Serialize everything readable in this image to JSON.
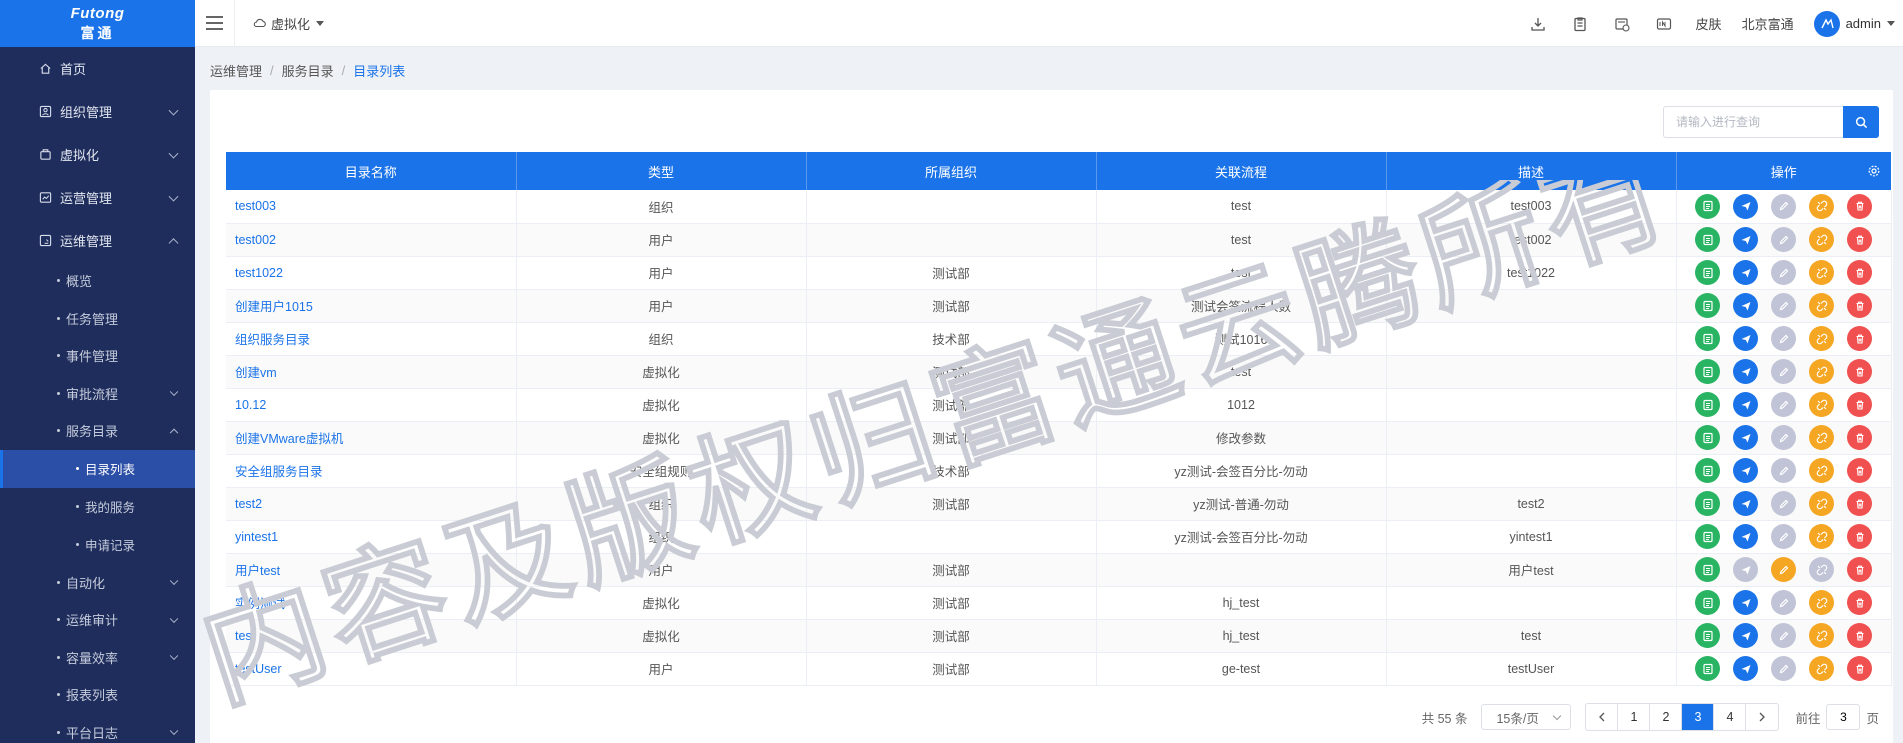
{
  "brand": {
    "name_en": "Futong",
    "name_cn": "富通",
    "color": "#1a73e8"
  },
  "sidebar": {
    "items": [
      {
        "label": "首页",
        "icon": "home-icon"
      },
      {
        "label": "组织管理",
        "icon": "org-icon"
      },
      {
        "label": "虚拟化",
        "icon": "virtualization-icon"
      },
      {
        "label": "运营管理",
        "icon": "operation-icon"
      },
      {
        "label": "运维管理",
        "icon": "maintenance-icon"
      }
    ],
    "sub_items": [
      {
        "label": "概览"
      },
      {
        "label": "任务管理"
      },
      {
        "label": "事件管理"
      },
      {
        "label": "审批流程"
      },
      {
        "label": "服务目录"
      }
    ],
    "catalog_children": [
      {
        "label": "目录列表"
      },
      {
        "label": "我的服务"
      },
      {
        "label": "申请记录"
      }
    ],
    "sub_items_after": [
      {
        "label": "自动化"
      },
      {
        "label": "运维审计"
      },
      {
        "label": "容量效率"
      },
      {
        "label": "报表列表"
      },
      {
        "label": "平台日志"
      }
    ]
  },
  "header": {
    "module": "虚拟化",
    "skin": "皮肤",
    "company": "北京富通",
    "user": "admin"
  },
  "breadcrumb": [
    "运维管理",
    "服务目录",
    "目录列表"
  ],
  "search": {
    "placeholder": "请输入进行查询"
  },
  "table": {
    "headers": [
      "目录名称",
      "类型",
      "所属组织",
      "关联流程",
      "描述",
      "操作"
    ],
    "rows": [
      [
        "test003",
        "组织",
        "",
        "test",
        "test003"
      ],
      [
        "test002",
        "用户",
        "",
        "test",
        "test002"
      ],
      [
        "test1022",
        "用户",
        "测试部",
        "test",
        "test1022"
      ],
      [
        "创建用户1015",
        "用户",
        "测试部",
        "测试会签流程人数",
        ""
      ],
      [
        "组织服务目录",
        "组织",
        "技术部",
        "测试1016",
        ""
      ],
      [
        "创建vm",
        "虚拟化",
        "测试部",
        "test",
        ""
      ],
      [
        "10.12",
        "虚拟化",
        "测试部",
        "1012",
        ""
      ],
      [
        "创建VMware虚拟机",
        "虚拟化",
        "测试部",
        "修改参数",
        ""
      ],
      [
        "安全组服务目录",
        "安全组规则",
        "技术部",
        "yz测试-会签百分比-勿动",
        ""
      ],
      [
        "test2",
        "组织",
        "测试部",
        "yz测试-普通-勿动",
        "test2"
      ],
      [
        "yintest1",
        "组织",
        "",
        "yz测试-会签百分比-勿动",
        "yintest1"
      ],
      [
        "用户test",
        "用户",
        "测试部",
        "",
        "用户test"
      ],
      [
        "实例测试",
        "虚拟化",
        "测试部",
        "hj_test",
        ""
      ],
      [
        "test",
        "虚拟化",
        "测试部",
        "hj_test",
        "test"
      ],
      [
        "testUser",
        "用户",
        "测试部",
        "ge-test",
        "testUser"
      ]
    ]
  },
  "pagination": {
    "total": "共 55 条",
    "page_size": "15条/页",
    "pages": [
      "1",
      "2",
      "3",
      "4"
    ],
    "current": "3",
    "goto_label": "前往",
    "goto_value": "3",
    "page_suffix": "页"
  },
  "watermark": "内容及版权归富通云腾所有"
}
